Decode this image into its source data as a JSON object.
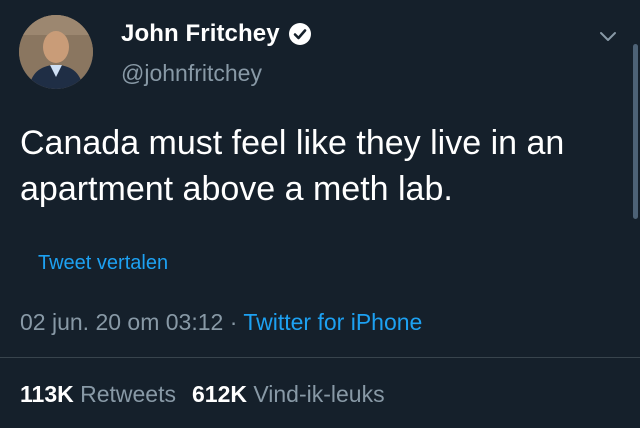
{
  "user": {
    "name": "John Fritchey",
    "handle": "@johnfritchey"
  },
  "tweet": {
    "text": "Canada must feel like they live in an apartment above a meth lab.",
    "translate_label": "Tweet vertalen"
  },
  "meta": {
    "date": "02 jun. 20 om 03:12",
    "separator": " · ",
    "source": "Twitter for iPhone"
  },
  "stats": {
    "retweets_count": "113K",
    "retweets_label": "Retweets",
    "likes_count": "612K",
    "likes_label": "Vind-ik-leuks"
  },
  "colors": {
    "background": "#15202b",
    "accent": "#1da1f2",
    "secondary_text": "#8899a6"
  },
  "icons": {
    "verified": "verified-badge-icon",
    "menu": "chevron-down-icon"
  }
}
